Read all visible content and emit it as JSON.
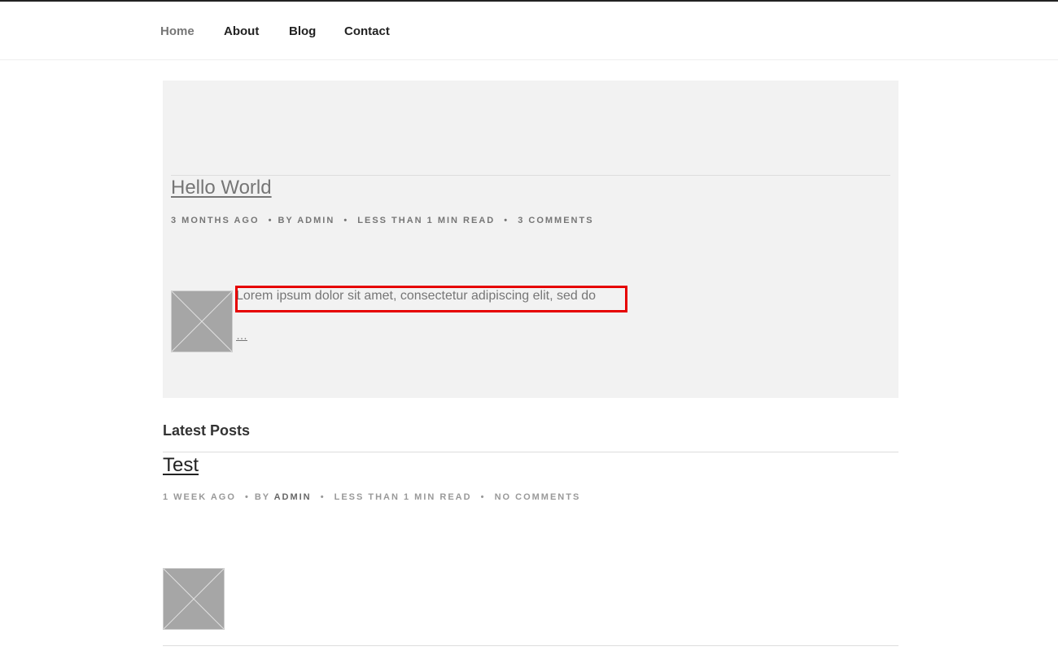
{
  "nav": {
    "items": [
      {
        "label": "Home"
      },
      {
        "label": "About"
      },
      {
        "label": "Blog"
      },
      {
        "label": "Contact"
      }
    ]
  },
  "featured": {
    "title": "Hello World",
    "meta": {
      "date": "3 MONTHS AGO",
      "by": "BY",
      "author": "ADMIN",
      "read_time": "LESS THAN 1 MIN READ",
      "comments": "3 COMMENTS"
    },
    "excerpt": "Lorem ipsum dolor sit amet, consectetur adipiscing elit, sed do",
    "more_link": "…",
    "thumbnail_icon": "image-placeholder-icon"
  },
  "latest": {
    "heading": "Latest Posts",
    "posts": [
      {
        "title": "Test",
        "meta": {
          "date": "1 WEEK AGO",
          "by": "BY",
          "author": "ADMIN",
          "read_time": "LESS THAN 1 MIN READ",
          "comments": "NO COMMENTS"
        },
        "thumbnail_icon": "image-placeholder-icon"
      }
    ]
  },
  "colors": {
    "highlight": "#e60000",
    "featured_bg": "#f2f2f2",
    "muted_text": "#767676"
  }
}
